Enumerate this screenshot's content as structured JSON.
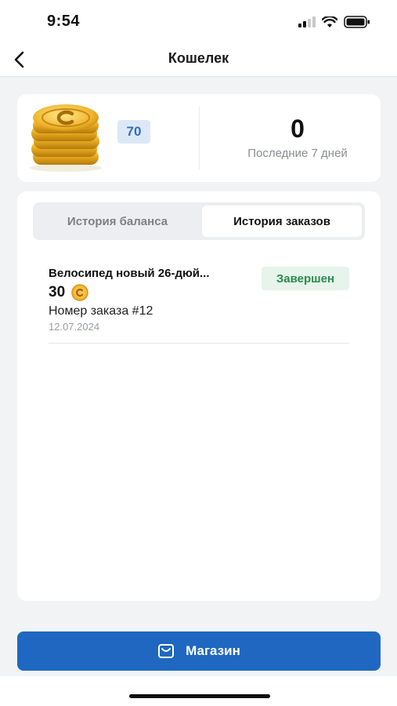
{
  "status_bar": {
    "time": "9:54"
  },
  "header": {
    "title": "Кошелек",
    "back_icon": "chevron-left-icon"
  },
  "balance": {
    "amount": "70",
    "coin_icon": "coin-stack-icon",
    "recent_value": "0",
    "recent_label": "Последние 7 дней"
  },
  "tabs": [
    {
      "label": "История баланса",
      "active": false
    },
    {
      "label": "История заказов",
      "active": true
    }
  ],
  "orders": [
    {
      "title": "Велосипед новый 26-дюй...",
      "price": "30",
      "status": "Завершен",
      "number": "Номер заказа #12",
      "date": "12.07.2024"
    }
  ],
  "footer": {
    "shop_label": "Магазин",
    "shop_icon": "shopping-bag-icon"
  },
  "colors": {
    "accent": "#1f67c0",
    "status_done_bg": "#e6f4ec",
    "status_done_text": "#2c8a4f",
    "coin": "#e7a91f"
  }
}
